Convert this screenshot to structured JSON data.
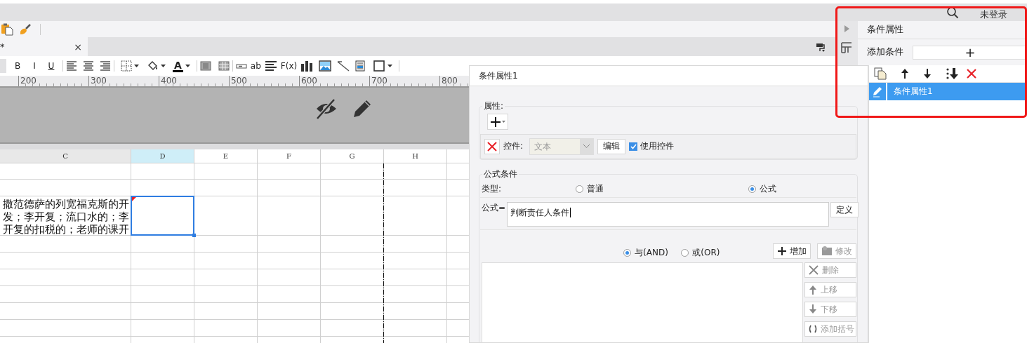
{
  "top_bar": {
    "user_status": "未登录"
  },
  "tab": {
    "label": "*",
    "close": "×"
  },
  "toolbar": {
    "bold": "B",
    "italic": "I",
    "underline": "U",
    "font_color": "A",
    "text_label": "ab",
    "formula": "F(x)"
  },
  "ruler": {
    "ticks": [
      "200",
      "300",
      "400",
      "500",
      "600",
      "700",
      "800"
    ]
  },
  "sheet": {
    "columns": [
      {
        "label": "C",
        "selected": false
      },
      {
        "label": "D",
        "selected": true
      },
      {
        "label": "E",
        "selected": false
      },
      {
        "label": "F",
        "selected": false
      },
      {
        "label": "G",
        "selected": false
      },
      {
        "label": "H",
        "selected": false
      }
    ],
    "cell_text": "撒范德萨的列宽福克斯的开发；李开复；流口水的；李开复的扣税的；老师的课开"
  },
  "dialog": {
    "title": "条件属性1",
    "attributes": {
      "legend": "属性:",
      "widget_label": "控件:",
      "widget_select": {
        "value": "文本",
        "disabled": true
      },
      "edit_button": "编辑",
      "use_widget": {
        "label": "使用控件",
        "checked": true
      }
    },
    "formula_condition": {
      "legend": "公式条件",
      "type_label": "类型:",
      "type_options": [
        {
          "label": "普通",
          "selected": false
        },
        {
          "label": "公式",
          "selected": true
        }
      ],
      "formula_label": "公式=",
      "formula_value": "判断责任人条件",
      "define_button": "定义",
      "logic_options": [
        {
          "label": "与(AND)",
          "selected": true
        },
        {
          "label": "或(OR)",
          "selected": false
        }
      ],
      "action_buttons": [
        {
          "label": "增加",
          "disabled": false
        },
        {
          "label": "修改",
          "disabled": true
        }
      ],
      "side_buttons": [
        {
          "label": "删除",
          "disabled": true
        },
        {
          "label": "上移",
          "disabled": true
        },
        {
          "label": "下移",
          "disabled": true
        },
        {
          "label": "添加括号",
          "disabled": true
        }
      ]
    }
  },
  "side_panel": {
    "title": "条件属性",
    "add_label": "添加条件",
    "add_button": "+",
    "items": [
      {
        "label": "条件属性1",
        "selected": true
      }
    ]
  }
}
